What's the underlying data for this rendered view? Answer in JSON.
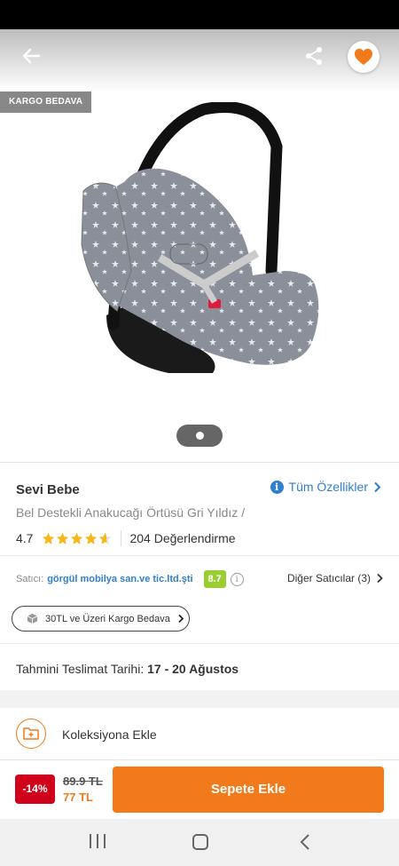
{
  "header": {
    "back_icon": "arrow-left-icon",
    "share_icon": "share-icon",
    "favorite_icon": "heart-icon",
    "favorite_color": "#f27a1a"
  },
  "media": {
    "badge": "KARGO BEDAVA",
    "image_count": 1,
    "current_image": 1
  },
  "product": {
    "brand": "Sevi Bebe",
    "all_features": "Tüm Özellikler",
    "name": "Bel Destekli Anakucağı Örtüsü Gri Yıldız /",
    "rating": "4.7",
    "rating_value": 4.7,
    "rating_max": 5,
    "reviews": "204 Değerlendirme"
  },
  "seller": {
    "label": "Satıcı:",
    "name": "görgül mobilya san.ve tic.ltd.şti",
    "score": "8.7",
    "other_sellers": "Diğer Satıcılar (3)"
  },
  "shipping": {
    "pill": "30TL ve Üzeri Kargo Bedava",
    "delivery_label": "Tahmini Teslimat Tarihi:",
    "delivery_dates": "17 - 20 Ağustos"
  },
  "collection": {
    "label": "Koleksiyona Ekle"
  },
  "buy": {
    "discount": "-14%",
    "old_price": "89.9 TL",
    "new_price": "77 TL",
    "add_to_cart": "Sepete Ekle"
  },
  "colors": {
    "accent": "#f27a1a",
    "link": "#2e7fd0",
    "discount": "#d0021b",
    "score": "#9acd32"
  }
}
